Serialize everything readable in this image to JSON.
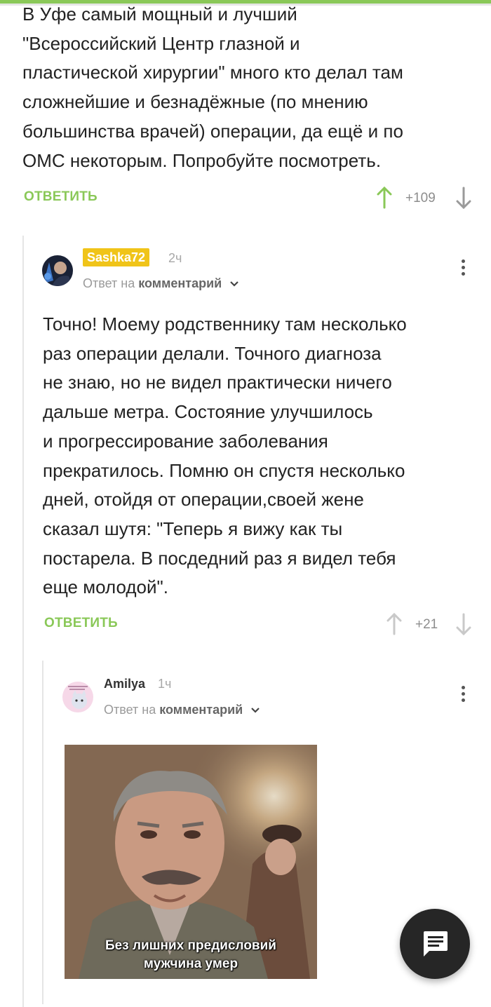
{
  "top_comment": {
    "lines": [
      "В Уфе самый мощный и лучший",
      "\"Всероссийский Центр глазной и",
      "пластической хирургии\" много кто делал там",
      "сложнейшие и безнадёжные (по мнению",
      "большинства врачей) операции, да ещё и по",
      "ОМС некоторым. Попробуйте посмотреть."
    ],
    "reply_label": "ОТВЕТИТЬ",
    "rating": "+109"
  },
  "reply1": {
    "username": "Sashka72",
    "time": "2ч",
    "reply_to_prefix": "Ответ на",
    "reply_to_target": "комментарий",
    "lines": [
      "Точно! Моему родственнику там несколько",
      "раз операции делали. Точного диагноза",
      "не знаю, но не видел практически ничего",
      "дальше метра. Состояние улучшилось",
      "и прогрессирование заболевания",
      "прекратилось. Помню он спустя несколько",
      "дней, отойдя от операции,своей жене",
      "сказал шутя: \"Теперь я вижу как ты",
      "постарела. В посдедний раз я видел тебя",
      "еще молодой\"."
    ],
    "reply_label": "ОТВЕТИТЬ",
    "rating": "+21"
  },
  "reply2": {
    "username": "Amilya",
    "time": "1ч",
    "reply_to_prefix": "Ответ на",
    "reply_to_target": "комментарий",
    "meme_caption_1": "Без лишних предисловий",
    "meme_caption_2": "мужчина умер"
  },
  "colors": {
    "accent_green": "#8ac858",
    "badge_yellow": "#f0c419",
    "muted": "#8d8d8d"
  }
}
